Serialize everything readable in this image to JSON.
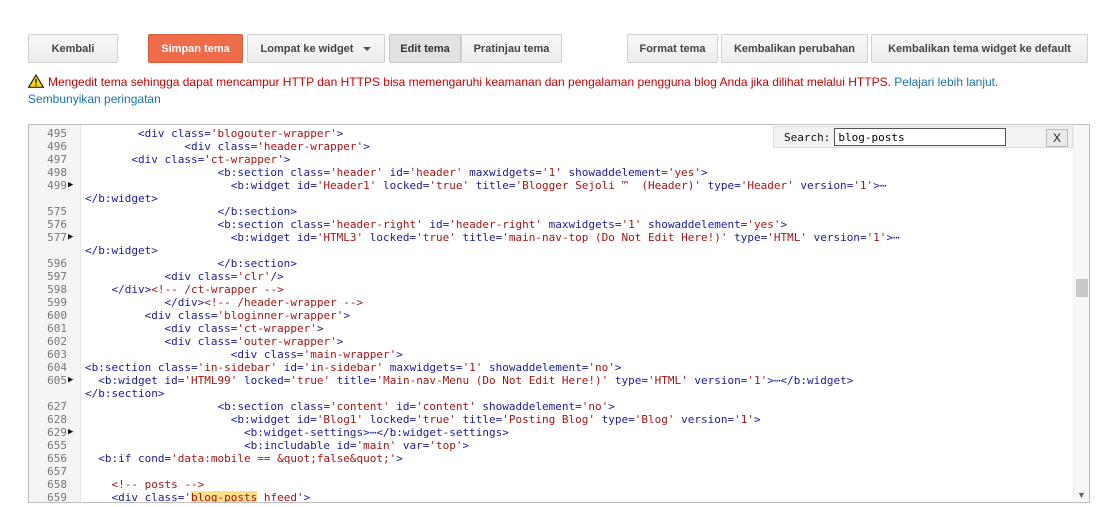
{
  "toolbar": {
    "back": "Kembali",
    "save": "Simpan tema",
    "jump": "Lompat ke widget",
    "edit": "Edit tema",
    "preview": "Pratinjau tema",
    "format": "Format tema",
    "revert": "Kembalikan perubahan",
    "reset_widgets": "Kembalikan tema widget ke default"
  },
  "warning": {
    "message": "Mengedit tema sehingga dapat mencampur HTTP dan HTTPS bisa memengaruhi keamanan dan pengalaman pengguna blog Anda jika dilihat melalui HTTPS.",
    "learn_more": "Pelajari lebih lanjut.",
    "hide": "Sembunyikan peringatan"
  },
  "search": {
    "label": "Search:",
    "value": "blog-posts",
    "close": "X"
  },
  "colors": {
    "save_button": "#ef6c4a",
    "warning_text": "#cc0000",
    "link": "#1a73a8",
    "highlight": "#ffe08a"
  },
  "code_lines": [
    {
      "n": "495",
      "fold": false,
      "ind": "        ",
      "t": "<div class='blogouter-wrapper'>"
    },
    {
      "n": "496",
      "fold": false,
      "ind": "               ",
      "t": "<div class='header-wrapper'>"
    },
    {
      "n": "497",
      "fold": false,
      "ind": "       ",
      "t": "<div class='ct-wrapper'>"
    },
    {
      "n": "498",
      "fold": false,
      "ind": "                    ",
      "t": "<b:section class='header' id='header' maxwidgets='1' showaddelement='yes'>"
    },
    {
      "n": "499",
      "fold": true,
      "ind": "                      ",
      "t": "<b:widget id='Header1' locked='true' title='Blogger Sejoli ™  (Header)' type='Header' version='1'>⋯"
    },
    {
      "n": "",
      "fold": false,
      "ind": "",
      "t": "</b:widget>"
    },
    {
      "n": "575",
      "fold": false,
      "ind": "                    ",
      "t": "</b:section>"
    },
    {
      "n": "576",
      "fold": false,
      "ind": "                    ",
      "t": "<b:section class='header-right' id='header-right' maxwidgets='1' showaddelement='yes'>"
    },
    {
      "n": "577",
      "fold": true,
      "ind": "                      ",
      "t": "<b:widget id='HTML3' locked='true' title='main-nav-top (Do Not Edit Here!)' type='HTML' version='1'>⋯"
    },
    {
      "n": "",
      "fold": false,
      "ind": "",
      "t": "</b:widget>"
    },
    {
      "n": "596",
      "fold": false,
      "ind": "                    ",
      "t": "</b:section>"
    },
    {
      "n": "597",
      "fold": false,
      "ind": "            ",
      "t": "<div class='clr'/>"
    },
    {
      "n": "598",
      "fold": false,
      "ind": "    ",
      "t": "</div><!-- /ct-wrapper -->"
    },
    {
      "n": "599",
      "fold": false,
      "ind": "            ",
      "t": "</div><!-- /header-wrapper -->"
    },
    {
      "n": "600",
      "fold": false,
      "ind": "         ",
      "t": "<div class='bloginner-wrapper'>"
    },
    {
      "n": "601",
      "fold": false,
      "ind": "            ",
      "t": "<div class='ct-wrapper'>"
    },
    {
      "n": "602",
      "fold": false,
      "ind": "            ",
      "t": "<div class='outer-wrapper'>"
    },
    {
      "n": "603",
      "fold": false,
      "ind": "                      ",
      "t": "<div class='main-wrapper'>"
    },
    {
      "n": "604",
      "fold": false,
      "ind": "",
      "t": "<b:section class='in-sidebar' id='in-sidebar' maxwidgets='1' showaddelement='no'>"
    },
    {
      "n": "605",
      "fold": true,
      "ind": "  ",
      "t": "<b:widget id='HTML99' locked='true' title='Main-nav-Menu (Do Not Edit Here!)' type='HTML' version='1'>⋯</b:widget>"
    },
    {
      "n": "",
      "fold": false,
      "ind": "",
      "t": "</b:section>"
    },
    {
      "n": "627",
      "fold": false,
      "ind": "                    ",
      "t": "<b:section class='content' id='content' showaddelement='no'>"
    },
    {
      "n": "628",
      "fold": false,
      "ind": "                      ",
      "t": "<b:widget id='Blog1' locked='true' title='Posting Blog' type='Blog' version='1'>"
    },
    {
      "n": "629",
      "fold": true,
      "ind": "                        ",
      "t": "<b:widget-settings>⋯</b:widget-settings>"
    },
    {
      "n": "655",
      "fold": false,
      "ind": "                        ",
      "t": "<b:includable id='main' var='top'>"
    },
    {
      "n": "656",
      "fold": false,
      "ind": "  ",
      "t": "<b:if cond='data:mobile == &quot;false&quot;'>"
    },
    {
      "n": "657",
      "fold": false,
      "ind": "",
      "t": ""
    },
    {
      "n": "658",
      "fold": false,
      "ind": "    ",
      "t": "<!-- posts -->"
    },
    {
      "n": "659",
      "fold": false,
      "ind": "    ",
      "t": "<div class='blog-posts hfeed'>"
    }
  ]
}
